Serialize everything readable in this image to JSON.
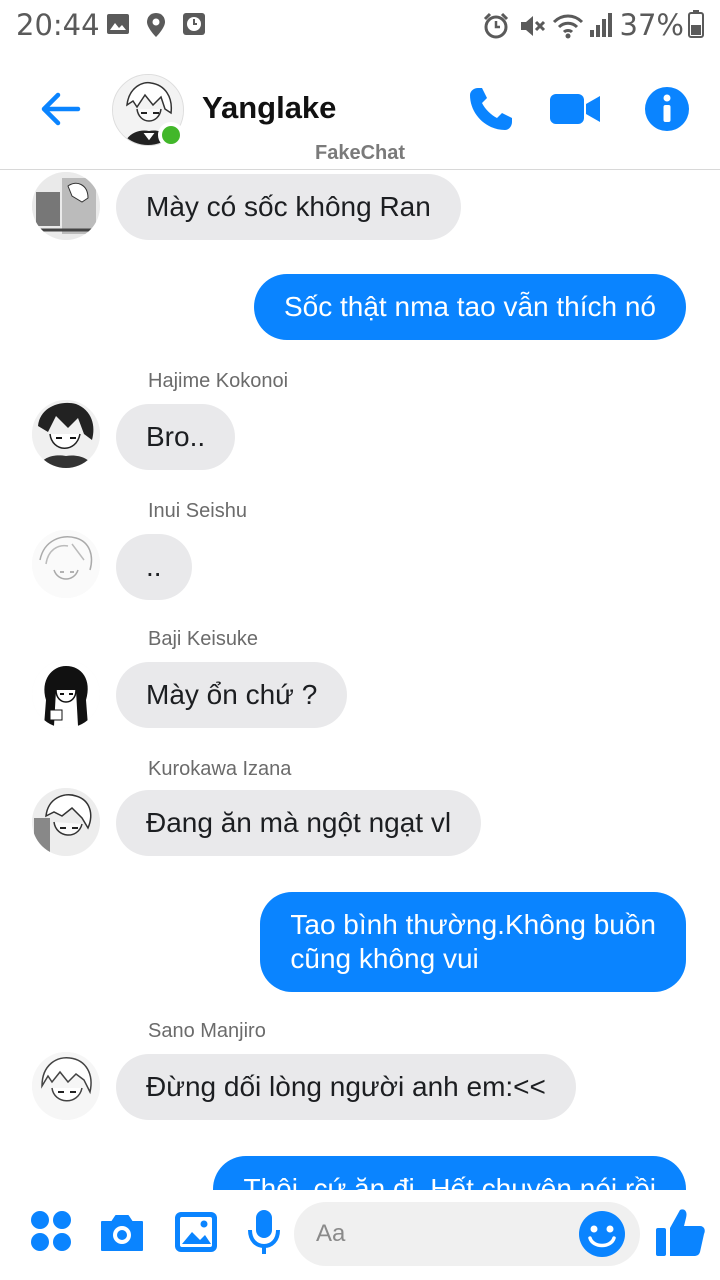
{
  "status_bar": {
    "time": "20:44",
    "battery": "37%",
    "icons": [
      "image-icon",
      "location-icon",
      "clock-icon",
      "alarm-icon",
      "mute-icon",
      "wifi-icon",
      "signal-icon",
      "battery-icon"
    ]
  },
  "header": {
    "contact_name": "Yanglake",
    "watermark": "FakeChat",
    "accent_color": "#0a84ff",
    "online_color": "#42b72a"
  },
  "messages": [
    {
      "sender": "",
      "text": "Mày có sốc không Ran",
      "direction": "incoming"
    },
    {
      "sender": "",
      "text": "Sốc thật nma tao vẫn thích nó",
      "direction": "outgoing"
    },
    {
      "sender": "Hajime Kokonoi",
      "text": "Bro..",
      "direction": "incoming"
    },
    {
      "sender": "Inui Seishu",
      "text": "..",
      "direction": "incoming"
    },
    {
      "sender": "Baji Keisuke",
      "text": "Mày ổn chứ ?",
      "direction": "incoming"
    },
    {
      "sender": "Kurokawa Izana",
      "text": "Đang ăn mà ngột ngạt vl",
      "direction": "incoming"
    },
    {
      "sender": "",
      "text_line1": "Tao bình thường.Không buồn",
      "text_line2": "cũng không vui",
      "direction": "outgoing"
    },
    {
      "sender": "Sano Manjiro",
      "text": "Đừng dối lòng người anh em:<<",
      "direction": "incoming"
    },
    {
      "sender": "",
      "text": "Thôi, cứ ăn đi. Hết chuyện nói rồi",
      "direction": "outgoing"
    }
  ],
  "composer": {
    "placeholder": "Aa",
    "value": ""
  }
}
